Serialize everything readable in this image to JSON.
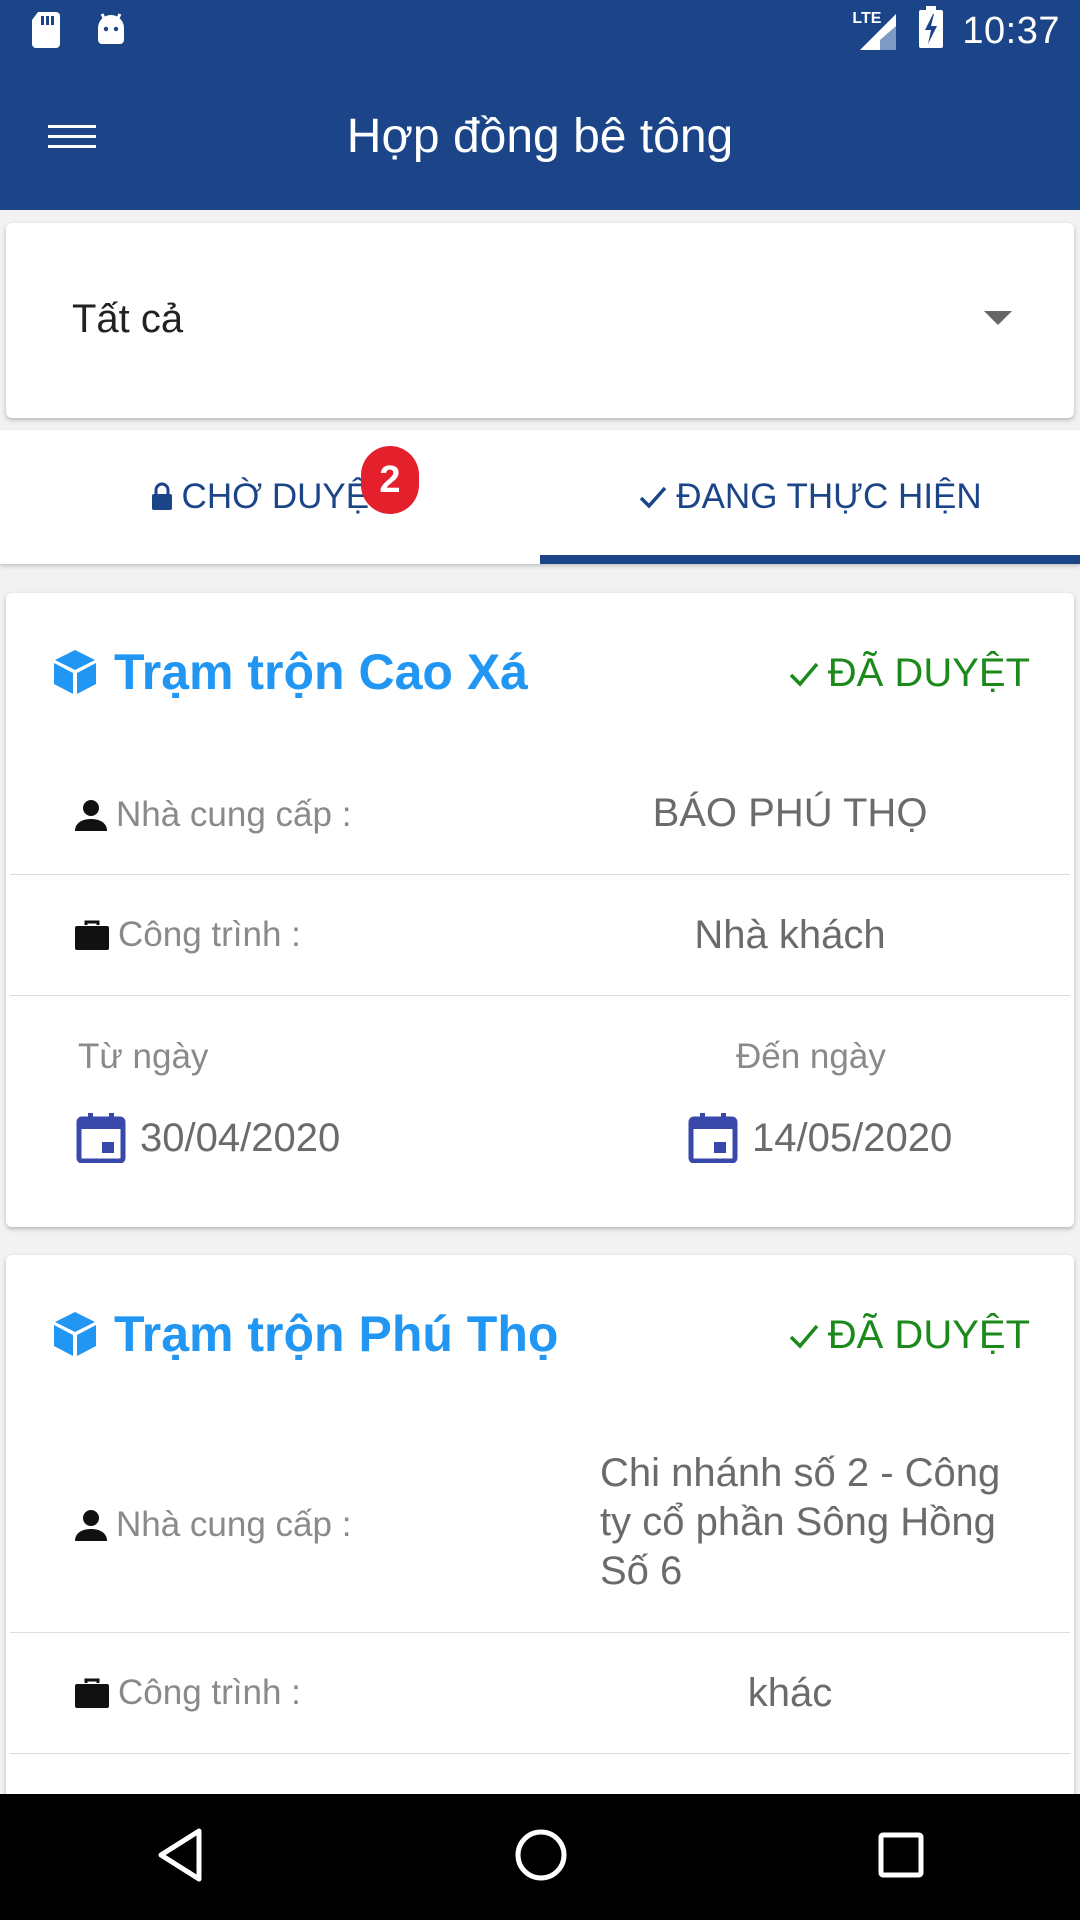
{
  "status_bar": {
    "network": "LTE",
    "time": "10:37"
  },
  "app_bar": {
    "title": "Hợp đồng bê tông"
  },
  "filter": {
    "selected": "Tất cả"
  },
  "tabs": [
    {
      "label": "CHỜ DUYỆT",
      "badge": "2",
      "icon": "lock-icon"
    },
    {
      "label": "ĐANG THỰC HIỆN",
      "icon": "check-icon",
      "active": true
    }
  ],
  "cards": [
    {
      "title": "Trạm trộn Cao Xá",
      "status": "ĐÃ DUYỆT",
      "supplier_label": "Nhà cung cấp :",
      "supplier": "BÁO PHÚ THỌ",
      "project_label": "Công trình :",
      "project": "Nhà khách",
      "from_label": "Từ ngày",
      "from_date": "30/04/2020",
      "to_label": "Đến ngày",
      "to_date": "14/05/2020"
    },
    {
      "title": "Trạm trộn Phú Thọ",
      "status": "ĐÃ DUYỆT",
      "supplier_label": "Nhà cung cấp :",
      "supplier": "Chi nhánh số 2 - Công ty cổ phần Sông Hồng Số 6",
      "project_label": "Công trình :",
      "project": "khác"
    }
  ],
  "colors": {
    "primary": "#1b4588",
    "title_blue": "#2196f3",
    "approved_green": "#1b8a1b",
    "badge_red": "#e5202d"
  }
}
